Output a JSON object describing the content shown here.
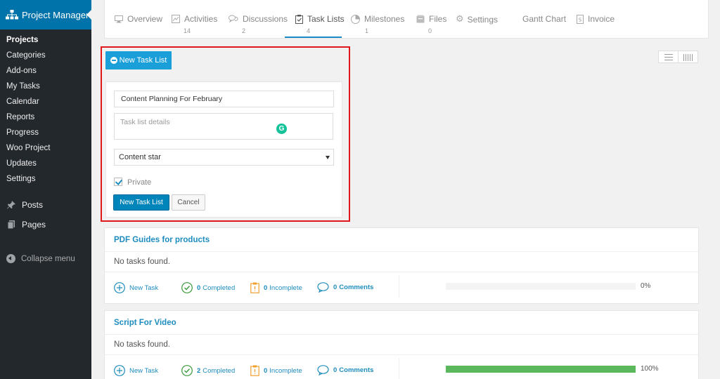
{
  "sidebar": {
    "header": "Project Manager",
    "sub_items": [
      "Projects",
      "Categories",
      "Add-ons",
      "My Tasks",
      "Calendar",
      "Reports",
      "Progress",
      "Woo Project",
      "Updates",
      "Settings"
    ],
    "main_items": [
      {
        "label": "Posts",
        "icon": "pin-icon"
      },
      {
        "label": "Pages",
        "icon": "pages-icon"
      }
    ],
    "collapse": "Collapse menu"
  },
  "tabs": [
    {
      "label": "Overview",
      "count": ""
    },
    {
      "label": "Activities",
      "count": "14"
    },
    {
      "label": "Discussions",
      "count": "2"
    },
    {
      "label": "Task Lists",
      "count": "4"
    },
    {
      "label": "Milestones",
      "count": "1"
    },
    {
      "label": "Files",
      "count": "0"
    },
    {
      "label": "Settings",
      "count": ""
    },
    {
      "label": "Gantt Chart",
      "count": ""
    },
    {
      "label": "Invoice",
      "count": ""
    }
  ],
  "form": {
    "toggle_button": "New Task List",
    "name_value": "Content Planning For February",
    "details_placeholder": "Task list details",
    "milestone_selected": "Content star",
    "private_label": "Private",
    "private_checked": true,
    "submit_label": "New Task List",
    "cancel_label": "Cancel"
  },
  "lists": [
    {
      "title": "PDF Guides for products",
      "empty_text": "No tasks found.",
      "new_task": "New Task",
      "completed_num": "0",
      "completed_label": "Completed",
      "incomplete_num": "0",
      "incomplete_label": "Incomplete",
      "comments_num": "0",
      "comments_label": "Comments",
      "progress": 0,
      "progress_text": "0%"
    },
    {
      "title": "Script For Video",
      "empty_text": "No tasks found.",
      "new_task": "New Task",
      "completed_num": "2",
      "completed_label": "Completed",
      "incomplete_num": "0",
      "incomplete_label": "Incomplete",
      "comments_num": "0",
      "comments_label": "Comments",
      "progress": 1,
      "progress_text": "100%"
    }
  ],
  "colors": {
    "accent": "#1a9fd9",
    "highlight_border": "#e0171b",
    "progress": "#5cb85c"
  }
}
